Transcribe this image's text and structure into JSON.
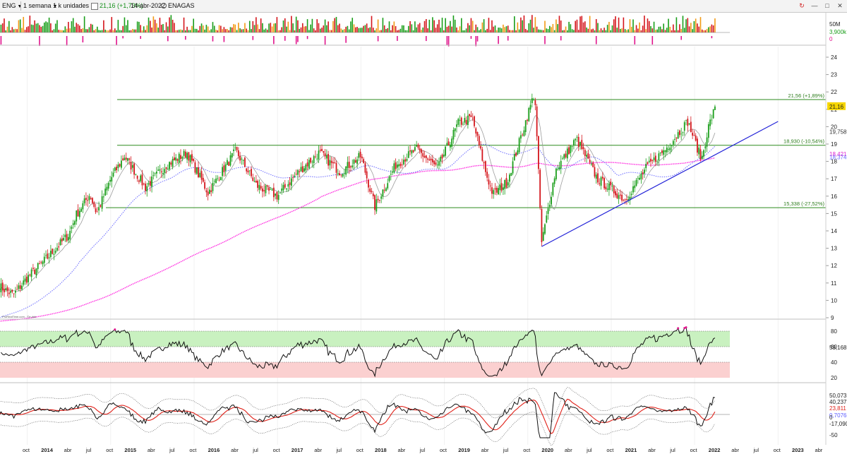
{
  "toolbar": {
    "symbol": "ENG",
    "period": "1 semana",
    "units": "1 k unidades",
    "quote": "21,16 (+1,73%)",
    "date": "14-abr-2022",
    "name": "ENAGAS"
  },
  "colors": {
    "up": "#1a9e1a",
    "down": "#d4161c",
    "sma_fast": "#9d9d9d",
    "sma_mid": "#6b6bff",
    "sma_slow": "#ff2ee0",
    "trend": "#2323d8",
    "level": "#2e8b1e",
    "overbought": "#c9f1c0",
    "oversold": "#fbd0d0"
  },
  "chart_data": [
    {
      "type": "candlestick",
      "panel": "price",
      "x_axis": {
        "start": "2013-09",
        "end": "2023-06",
        "labels": [
          "oct",
          "2014",
          "abr",
          "jul",
          "oct",
          "2015",
          "abr",
          "jul",
          "oct",
          "2016",
          "abr",
          "jul",
          "oct",
          "2017",
          "abr",
          "jul",
          "oct",
          "2018",
          "abr",
          "jul",
          "oct",
          "2019",
          "abr",
          "jul",
          "oct",
          "2020",
          "abr",
          "jul",
          "oct",
          "2021",
          "abr",
          "jul",
          "oct",
          "2022",
          "abr",
          "jul",
          "oct",
          "2023",
          "abr"
        ]
      },
      "y_axis": {
        "min": 8,
        "max": 25,
        "ticks": [
          9,
          10,
          11,
          12,
          13,
          14,
          15,
          16,
          17,
          18,
          19,
          20,
          21,
          22,
          23,
          24
        ]
      },
      "close_path": [
        {
          "date": "2013-09",
          "close": 10.8
        },
        {
          "date": "2013-11",
          "close": 10.3
        },
        {
          "date": "2014-01",
          "close": 11.3
        },
        {
          "date": "2014-04",
          "close": 12.5
        },
        {
          "date": "2014-07",
          "close": 13.8
        },
        {
          "date": "2014-08",
          "close": 14.9
        },
        {
          "date": "2014-10",
          "close": 16.1
        },
        {
          "date": "2014-11",
          "close": 15.0
        },
        {
          "date": "2015-01",
          "close": 17.0
        },
        {
          "date": "2015-03",
          "close": 18.3
        },
        {
          "date": "2015-06",
          "close": 16.5
        },
        {
          "date": "2015-09",
          "close": 17.8
        },
        {
          "date": "2015-12",
          "close": 18.5
        },
        {
          "date": "2016-03",
          "close": 16.2
        },
        {
          "date": "2016-07",
          "close": 18.6
        },
        {
          "date": "2016-10",
          "close": 16.6
        },
        {
          "date": "2017-01",
          "close": 16.0
        },
        {
          "date": "2017-04",
          "close": 17.4
        },
        {
          "date": "2017-07",
          "close": 18.5
        },
        {
          "date": "2017-10",
          "close": 17.4
        },
        {
          "date": "2018-01",
          "close": 18.3
        },
        {
          "date": "2018-03",
          "close": 15.4
        },
        {
          "date": "2018-06",
          "close": 17.8
        },
        {
          "date": "2018-09",
          "close": 18.7
        },
        {
          "date": "2018-12",
          "close": 17.6
        },
        {
          "date": "2019-03",
          "close": 20.2
        },
        {
          "date": "2019-05",
          "close": 20.5
        },
        {
          "date": "2019-07",
          "close": 17.3
        },
        {
          "date": "2019-08",
          "close": 16.1
        },
        {
          "date": "2019-10",
          "close": 16.8
        },
        {
          "date": "2019-12",
          "close": 19.4
        },
        {
          "date": "2020-02",
          "close": 22.0
        },
        {
          "date": "2020-03",
          "close": 13.3
        },
        {
          "date": "2020-05",
          "close": 17.5
        },
        {
          "date": "2020-08",
          "close": 19.3
        },
        {
          "date": "2020-11",
          "close": 17.0
        },
        {
          "date": "2021-03",
          "close": 15.8
        },
        {
          "date": "2021-06",
          "close": 17.6
        },
        {
          "date": "2021-09",
          "close": 18.8
        },
        {
          "date": "2021-12",
          "close": 20.3
        },
        {
          "date": "2022-02",
          "close": 18.1
        },
        {
          "date": "2022-03",
          "close": 20.0
        },
        {
          "date": "2022-04",
          "close": 21.16
        }
      ],
      "last_price": "21,16",
      "moving_averages": [
        {
          "label": "19,758",
          "last": 19.758
        },
        {
          "label": "18,421",
          "last": 18.421
        },
        {
          "label": "18,374",
          "last": 18.374
        }
      ],
      "levels": [
        {
          "value": 21.56,
          "label": "21,56 (+1,89%)"
        },
        {
          "value": 18.93,
          "label": "18,930 (-10,54%)"
        },
        {
          "value": 15.338,
          "label": "15,338 (-27,52%)"
        }
      ],
      "trendline": {
        "from": {
          "date": "2020-03",
          "value": 13.1
        },
        "to": {
          "date": "2023-01",
          "value": 20.3
        }
      },
      "watermark": "ProRealTime.com - ©e-dsb"
    },
    {
      "type": "bar",
      "panel": "volume",
      "y_ticks": [
        "50M",
        "3,900k",
        "0"
      ]
    },
    {
      "type": "line",
      "panel": "rsi",
      "y_axis": {
        "min": 18,
        "max": 90,
        "ticks": [
          20,
          40,
          60,
          80
        ]
      },
      "zones": {
        "overbought": [
          60,
          80
        ],
        "oversold": [
          20,
          40
        ]
      },
      "last": "59,168"
    },
    {
      "type": "line",
      "panel": "oscillator",
      "labels": [
        "50,073",
        "40,237",
        "23,811",
        "0,7076",
        "0",
        "-17,090",
        "-50"
      ]
    }
  ]
}
